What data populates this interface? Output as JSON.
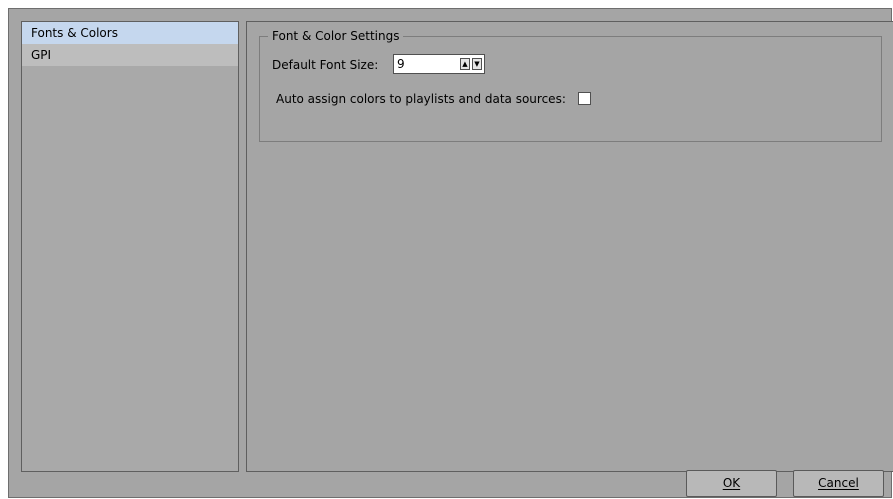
{
  "sidebar": {
    "items": [
      {
        "label": "Fonts & Colors",
        "selected": true
      },
      {
        "label": "GPI",
        "selected": false
      }
    ]
  },
  "settings": {
    "group_title": "Font & Color Settings",
    "font_size_label": "Default Font Size:",
    "font_size_value": "9",
    "spin_up_glyph": "▲",
    "spin_down_glyph": "▼",
    "auto_assign_label": "Auto assign colors to playlists and data sources:",
    "auto_assign_checked": false
  },
  "buttons": {
    "ok_label": "OK",
    "cancel_label": "Cancel"
  },
  "colors": {
    "dialog_bg": "#a5a5a5",
    "selected_item_bg": "#c5d7ee"
  }
}
